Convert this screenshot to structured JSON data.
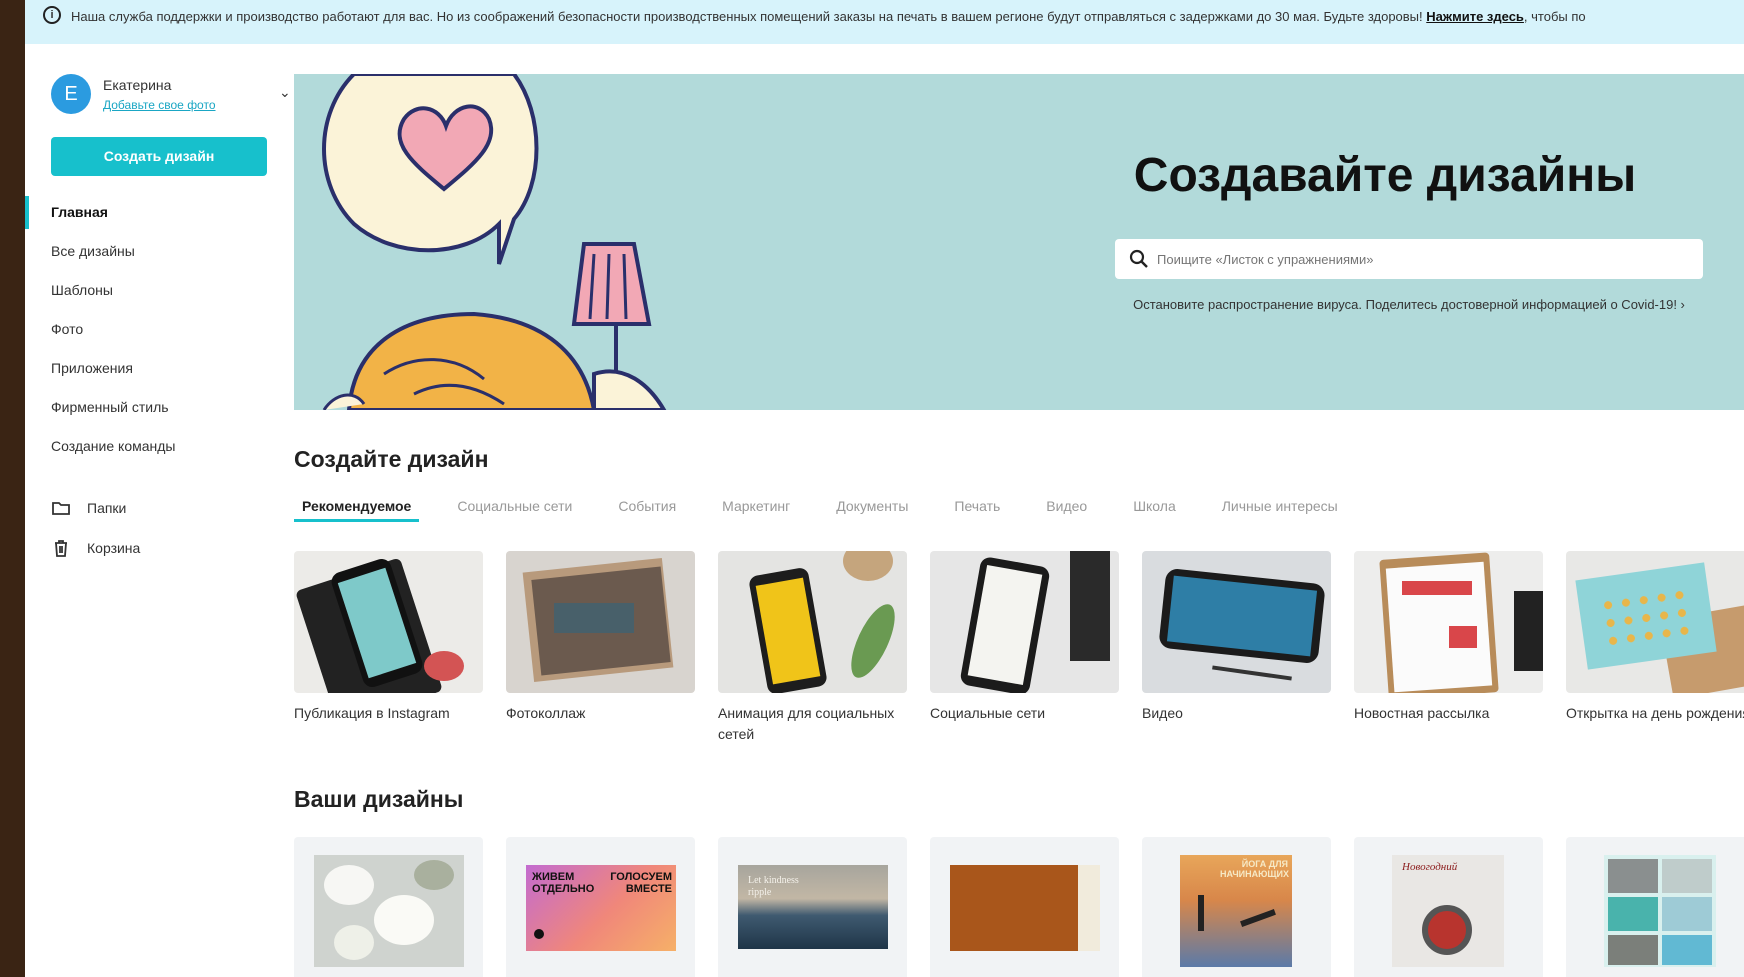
{
  "banner": {
    "text": "Наша служба поддержки и производство работают для вас. Но из соображений безопасности производственных помещений заказы на печать в вашем регионе будут отправляться с задержками до 30 мая. Будьте здоровы!",
    "link": "Нажмите здесь",
    "tail": ", чтобы по"
  },
  "user": {
    "initial": "E",
    "name": "Екатерина",
    "add_photo": "Добавьте свое фото"
  },
  "sidebar": {
    "create_button": "Создать дизайн",
    "items": [
      {
        "label": "Главная",
        "active": true
      },
      {
        "label": "Все дизайны"
      },
      {
        "label": "Шаблоны"
      },
      {
        "label": "Фото"
      },
      {
        "label": "Приложения"
      },
      {
        "label": "Фирменный стиль"
      },
      {
        "label": "Создание команды"
      }
    ],
    "folders": "Папки",
    "trash": "Корзина"
  },
  "hero": {
    "title": "Создавайте дизайны",
    "search_placeholder": "Поищите «Листок с упражнениями»",
    "note": "Остановите распространение вируса. Поделитесь достоверной информацией о Covid-19! ›"
  },
  "create_section": {
    "title": "Создайте дизайн",
    "tabs": [
      "Рекомендуемое",
      "Социальные сети",
      "События",
      "Маркетинг",
      "Документы",
      "Печать",
      "Видео",
      "Школа",
      "Личные интересы"
    ],
    "cards": [
      {
        "label": "Публикация в Instagram"
      },
      {
        "label": "Фотоколлаж"
      },
      {
        "label": "Анимация для социальных сетей"
      },
      {
        "label": "Социальные сети"
      },
      {
        "label": "Видео"
      },
      {
        "label": "Новостная рассылка"
      },
      {
        "label": "Открытка на день рождения"
      }
    ]
  },
  "your_designs": {
    "title": "Ваши дизайны",
    "thumb_texts": [
      "ЖИВЕМ ОТДЕЛЬНО",
      "ГОЛОСУЕМ ВМЕСТЕ",
      "Let kindness ripple",
      "ЙОГА ДЛЯ НАЧИНАЮЩИХ",
      "Новогодний"
    ]
  },
  "colors": {
    "accent": "#17c0cc",
    "hero_bg": "#b2dada",
    "banner_bg": "#d7f3fb"
  }
}
